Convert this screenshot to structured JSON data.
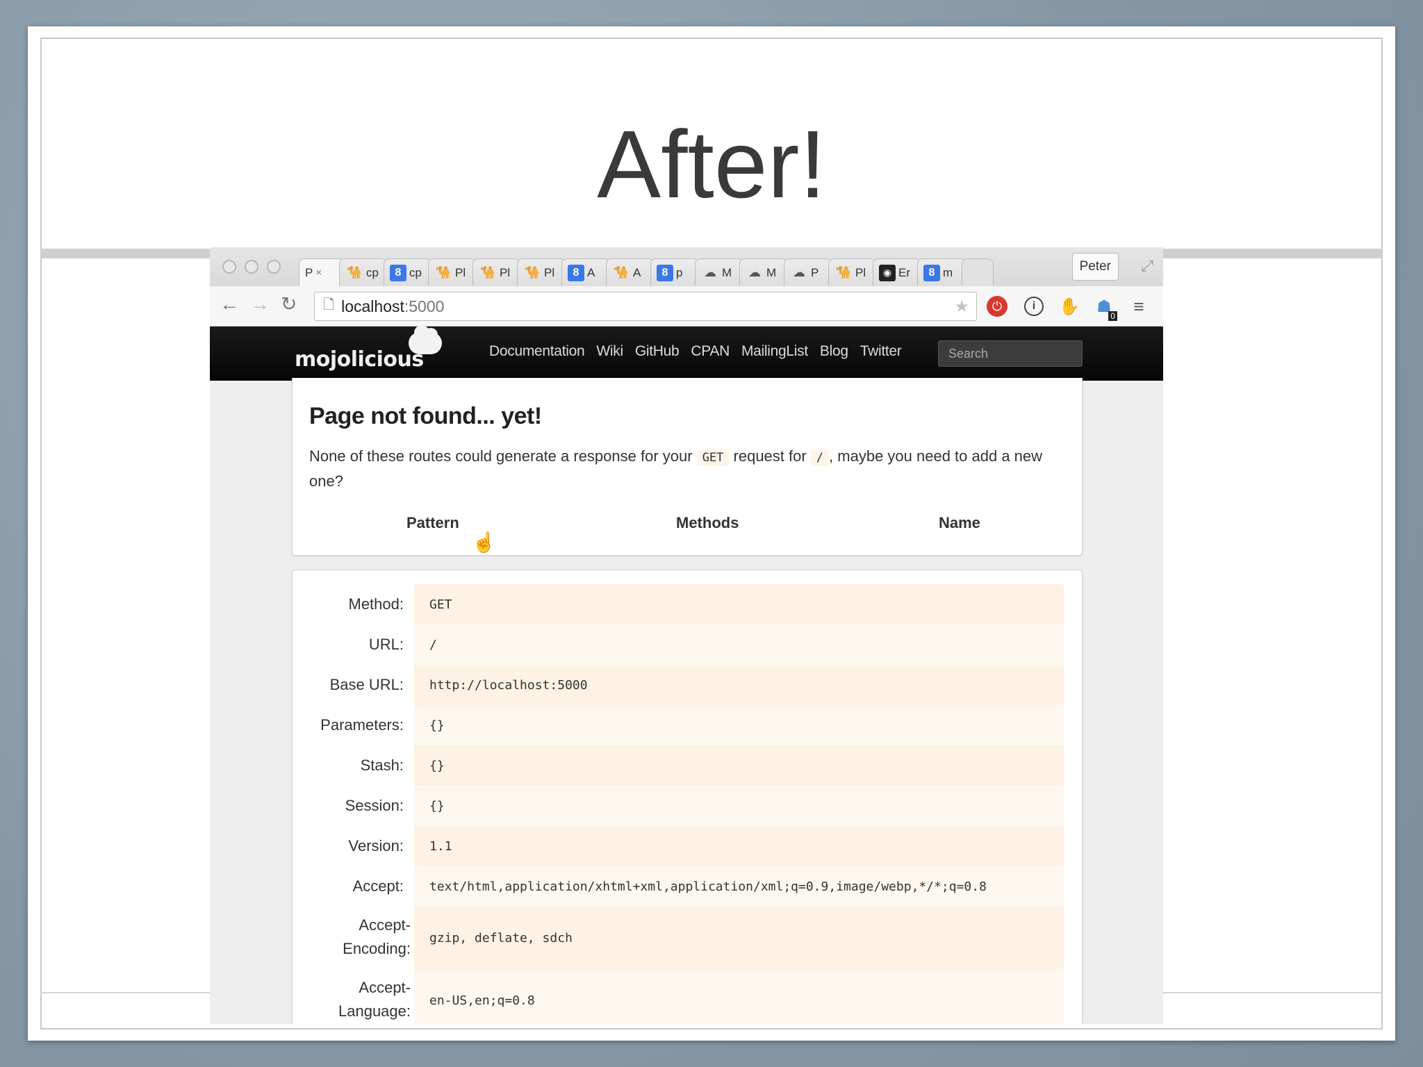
{
  "slide": {
    "title": "After!"
  },
  "browser": {
    "tabs": [
      {
        "icon": "camel",
        "label": "P",
        "active": true
      },
      {
        "icon": "camel",
        "label": "cp"
      },
      {
        "icon": "google",
        "label": "cp"
      },
      {
        "icon": "camel",
        "label": "Pl"
      },
      {
        "icon": "camel",
        "label": "Pl"
      },
      {
        "icon": "camel",
        "label": "Pl"
      },
      {
        "icon": "google",
        "label": "A"
      },
      {
        "icon": "camel",
        "label": "A"
      },
      {
        "icon": "google",
        "label": "p"
      },
      {
        "icon": "cloud",
        "label": "M"
      },
      {
        "icon": "cloud",
        "label": "M"
      },
      {
        "icon": "cloud",
        "label": "P"
      },
      {
        "icon": "camel",
        "label": "Pl"
      },
      {
        "icon": "dark",
        "label": "Er"
      },
      {
        "icon": "google",
        "label": "m"
      }
    ],
    "profile": "Peter",
    "url_host": "localhost",
    "url_port": ":5000"
  },
  "mojo": {
    "logo": "mojolicious",
    "links": [
      "Documentation",
      "Wiki",
      "GitHub",
      "CPAN",
      "MailingList",
      "Blog",
      "Twitter"
    ],
    "search_placeholder": "Search"
  },
  "not_found": {
    "title": "Page not found... yet!",
    "text_before": "None of these routes could generate a response for your ",
    "method_code": "GET",
    "text_middle": " request for ",
    "path_code": "/",
    "text_after": ", maybe you need to add a new one?",
    "columns": [
      "Pattern",
      "Methods",
      "Name"
    ]
  },
  "request_info": [
    {
      "label": "Method:",
      "value": "GET"
    },
    {
      "label": "URL:",
      "value": "/"
    },
    {
      "label": "Base URL:",
      "value": "http://localhost:5000"
    },
    {
      "label": "Parameters:",
      "value": "{}"
    },
    {
      "label": "Stash:",
      "value": "{}"
    },
    {
      "label": "Session:",
      "value": "{}"
    },
    {
      "label": "Version:",
      "value": "1.1"
    },
    {
      "label": "Accept:",
      "value": "text/html,application/xhtml+xml,application/xml;q=0.9,image/webp,*/*;q=0.8"
    },
    {
      "label": "Accept-Encoding:",
      "value": "gzip, deflate, sdch"
    },
    {
      "label": "Accept-Language:",
      "value": "en-US,en;q=0.8"
    }
  ]
}
